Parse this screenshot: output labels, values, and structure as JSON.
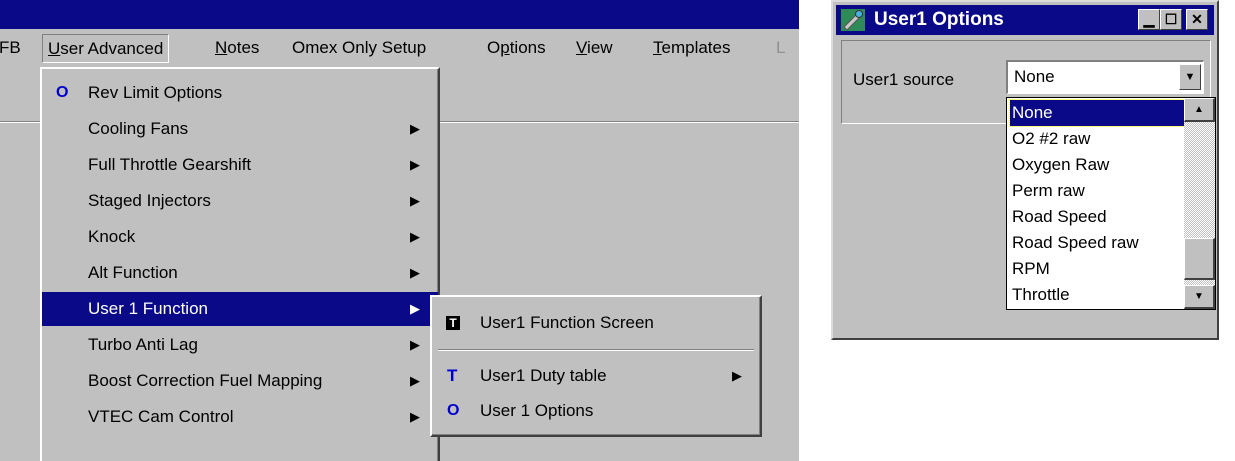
{
  "menubar": {
    "items": [
      {
        "label": "FB"
      },
      {
        "label": "User Advanced"
      },
      {
        "label": "Notes"
      },
      {
        "label": "Omex Only Setup"
      },
      {
        "label": "Options"
      },
      {
        "label": "View"
      },
      {
        "label": "Templates"
      },
      {
        "label": "L"
      }
    ]
  },
  "user_advanced_menu": {
    "items": [
      {
        "label": "Rev Limit Options",
        "glyph": "O",
        "has_submenu": false
      },
      {
        "label": "Cooling Fans",
        "has_submenu": true
      },
      {
        "label": "Full Throttle Gearshift",
        "has_submenu": true
      },
      {
        "label": "Staged Injectors",
        "has_submenu": true
      },
      {
        "label": "Knock",
        "has_submenu": true
      },
      {
        "label": "Alt Function",
        "has_submenu": true
      },
      {
        "label": "User 1 Function",
        "has_submenu": true,
        "highlighted": true
      },
      {
        "label": "Turbo Anti Lag",
        "has_submenu": true
      },
      {
        "label": "Boost Correction Fuel Mapping",
        "has_submenu": true
      },
      {
        "label": "VTEC Cam Control",
        "has_submenu": true
      }
    ],
    "arrow": "▶"
  },
  "user1_submenu": {
    "items": [
      {
        "label": "User1 Function Screen",
        "glyph": "T"
      },
      {
        "label": "User1 Duty table",
        "glyph": "T",
        "has_submenu": true
      },
      {
        "label": "User 1 Options",
        "glyph": "O"
      }
    ]
  },
  "dialog": {
    "title": "User1 Options",
    "title_buttons": [
      "minimize",
      "maximize",
      "close"
    ],
    "source_label": "User1 source",
    "selected_value": "None",
    "options": [
      "None",
      "O2 #2 raw",
      "Oxygen Raw",
      "Perm raw",
      "Road Speed",
      "Road Speed raw",
      "RPM",
      "Throttle"
    ],
    "selected_index": 0
  },
  "colors": {
    "window_face": "#c0c0c0",
    "selection": "#0a0a88",
    "glyph_blue": "#0000cc"
  }
}
